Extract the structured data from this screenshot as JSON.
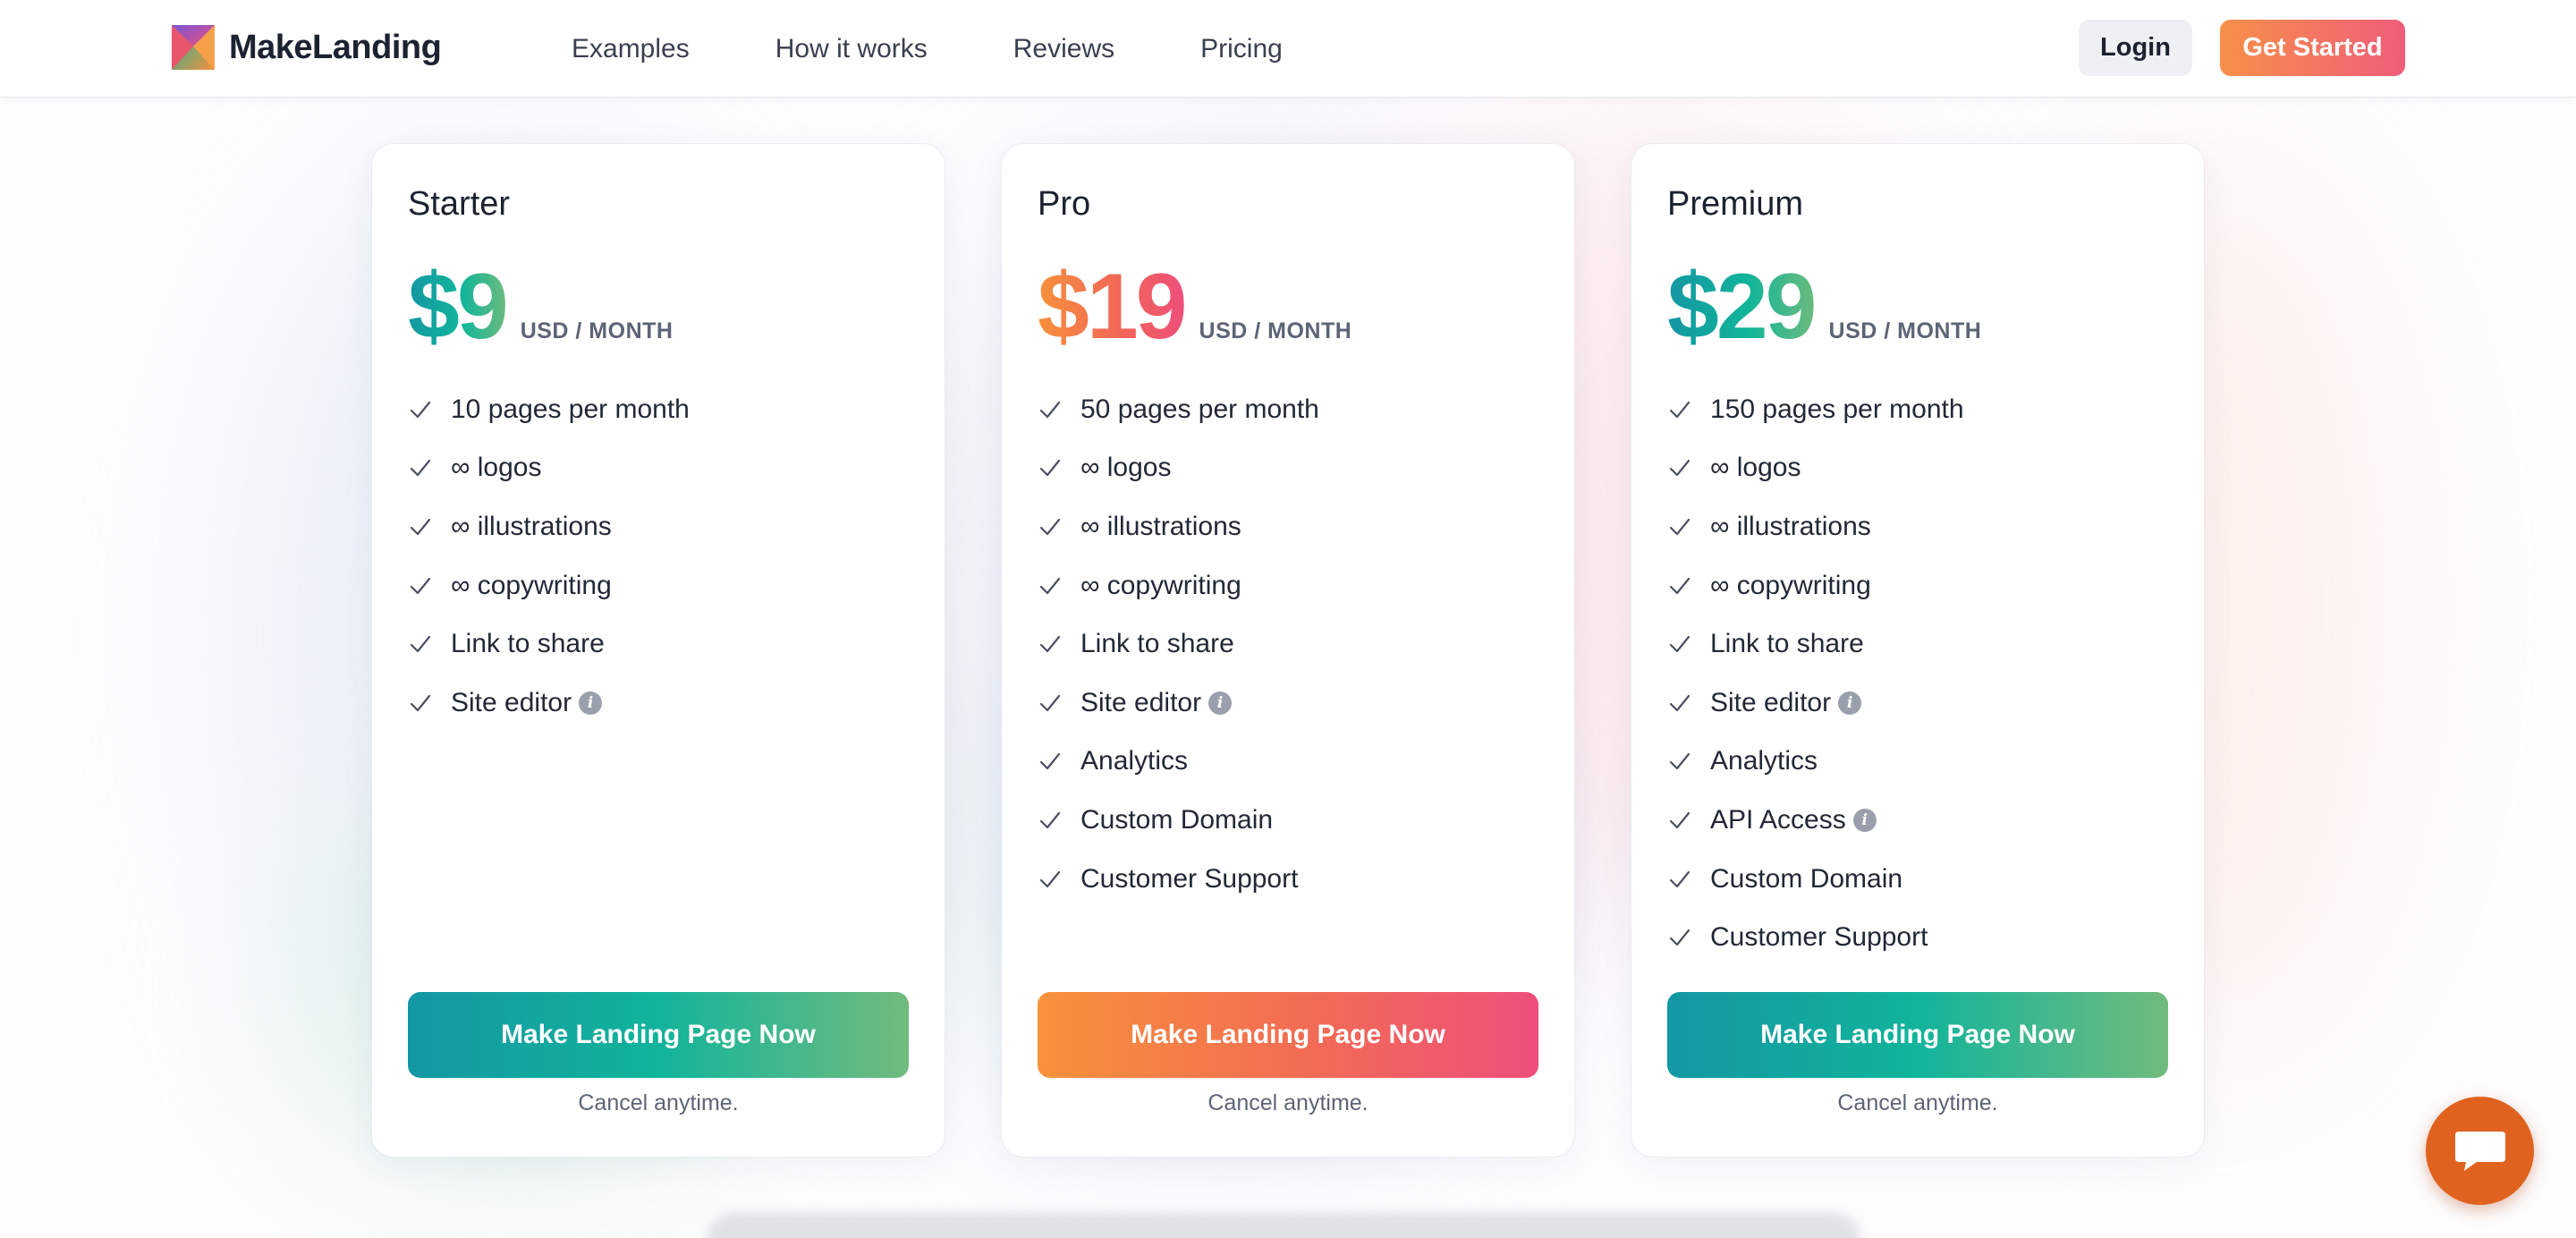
{
  "brand": {
    "name": "MakeLanding"
  },
  "nav": {
    "items": [
      {
        "label": "Examples"
      },
      {
        "label": "How it works"
      },
      {
        "label": "Reviews"
      },
      {
        "label": "Pricing"
      }
    ],
    "login_label": "Login",
    "get_started_label": "Get Started"
  },
  "colors": {
    "accent_orange": "#f7913c",
    "accent_pink": "#ee4f7b",
    "accent_teal": "#1497a3",
    "accent_green": "#6cbb7e",
    "chat_orange": "#e0621f"
  },
  "plans": [
    {
      "name": "Starter",
      "price": "$9",
      "unit": "USD / MONTH",
      "features": [
        {
          "text": "10 pages per month"
        },
        {
          "text": "∞ logos"
        },
        {
          "text": "∞ illustrations"
        },
        {
          "text": "∞ copywriting"
        },
        {
          "text": "Link to share"
        },
        {
          "text": "Site editor",
          "info": "i"
        }
      ],
      "cta": "Make Landing Page Now",
      "note": "Cancel anytime."
    },
    {
      "name": "Pro",
      "price": "$19",
      "unit": "USD / MONTH",
      "features": [
        {
          "text": "50 pages per month"
        },
        {
          "text": "∞ logos"
        },
        {
          "text": "∞ illustrations"
        },
        {
          "text": "∞ copywriting"
        },
        {
          "text": "Link to share"
        },
        {
          "text": "Site editor",
          "info": "i"
        },
        {
          "text": "Analytics"
        },
        {
          "text": "Custom Domain"
        },
        {
          "text": "Customer Support"
        }
      ],
      "cta": "Make Landing Page Now",
      "note": "Cancel anytime."
    },
    {
      "name": "Premium",
      "price": "$29",
      "unit": "USD / MONTH",
      "features": [
        {
          "text": "150 pages per month"
        },
        {
          "text": "∞ logos"
        },
        {
          "text": "∞ illustrations"
        },
        {
          "text": "∞ copywriting"
        },
        {
          "text": "Link to share"
        },
        {
          "text": "Site editor",
          "info": "i"
        },
        {
          "text": "Analytics"
        },
        {
          "text": "API Access",
          "info": "i"
        },
        {
          "text": "Custom Domain"
        },
        {
          "text": "Customer Support"
        }
      ],
      "cta": "Make Landing Page Now",
      "note": "Cancel anytime."
    }
  ],
  "chat": {
    "icon": "chat-bubble-icon"
  }
}
